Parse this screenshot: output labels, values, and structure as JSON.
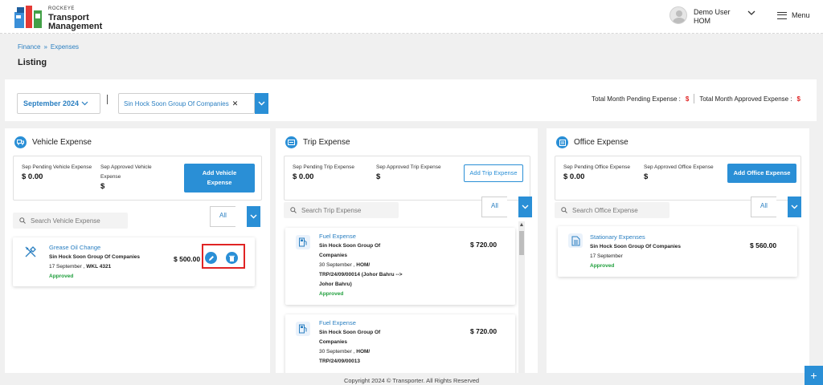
{
  "header": {
    "brand_small": "ROCKEYE",
    "brand_line1": "Transport",
    "brand_line2": "Management",
    "user_name": "Demo User",
    "user_role": "HOM",
    "menu_label": "Menu"
  },
  "breadcrumb": {
    "item1": "Finance",
    "separator": "»",
    "item2": "Expenses"
  },
  "page_title": "Listing",
  "filters": {
    "month": "September 2024",
    "company": "Sin Hock Soon Group Of Companies",
    "total_pending_label": "Total Month Pending Expense :",
    "total_pending_value": "$",
    "total_approved_label": "Total Month Approved Expense :",
    "total_approved_value": "$"
  },
  "vehicle": {
    "title": "Vehicle Expense",
    "pending_label": "Sep Pending Vehicle Expense",
    "pending_value": "$ 0.00",
    "approved_label": "Sep Approved Vehicle Expense",
    "approved_value": "$",
    "add_label": "Add Vehicle Expense",
    "search_placeholder": "Search Vehicle Expense",
    "filter_value": "All",
    "items": [
      {
        "title": "Grease Oil Change",
        "company": "Sin Hock Soon Group Of Companies",
        "date": "17 September ,",
        "ref": "WKL 4321",
        "status": "Approved",
        "amount": "$ 500.00"
      }
    ]
  },
  "trip": {
    "title": "Trip Expense",
    "pending_label": "Sep Pending Trip Expense",
    "pending_value": "$ 0.00",
    "approved_label": "Sep Approved Trip Expense",
    "approved_value": "$",
    "add_label": "Add Trip Expense",
    "search_placeholder": "Search Trip Expense",
    "filter_value": "All",
    "items": [
      {
        "title": "Fuel Expense",
        "company1": "Sin Hock Soon Group Of",
        "company2": "Companies",
        "date": "30 September ,",
        "ref1": "HOM/",
        "ref2": "TRP/24/09/00014 (Johor Bahru -->",
        "ref3": "Johor Bahru)",
        "status": "Approved",
        "amount": "$ 720.00"
      },
      {
        "title": "Fuel Expense",
        "company1": "Sin Hock Soon Group Of",
        "company2": "Companies",
        "date": "30 September ,",
        "ref1": "HOM/",
        "ref2": "TRP/24/09/00013",
        "amount": "$ 720.00"
      }
    ]
  },
  "office": {
    "title": "Office Expense",
    "pending_label": "Sep Pending Office Expense",
    "pending_value": "$ 0.00",
    "approved_label": "Sep Approved Office Expense",
    "approved_value": "$",
    "add_label": "Add Office Expense",
    "search_placeholder": "Search Office Expense",
    "filter_value": "All",
    "items": [
      {
        "title": "Stationary Expenses",
        "company": "Sin Hock Soon Group Of Companies",
        "date": "17 September",
        "status": "Approved",
        "amount": "$ 560.00"
      }
    ]
  },
  "footer": {
    "copyright": "Copyright 2024 © Transporter. All Rights Reserved"
  },
  "colors": {
    "accent": "#2a8fd6",
    "link": "#2a7fc1",
    "approved": "#1e9e3b",
    "alert": "#e02424"
  }
}
